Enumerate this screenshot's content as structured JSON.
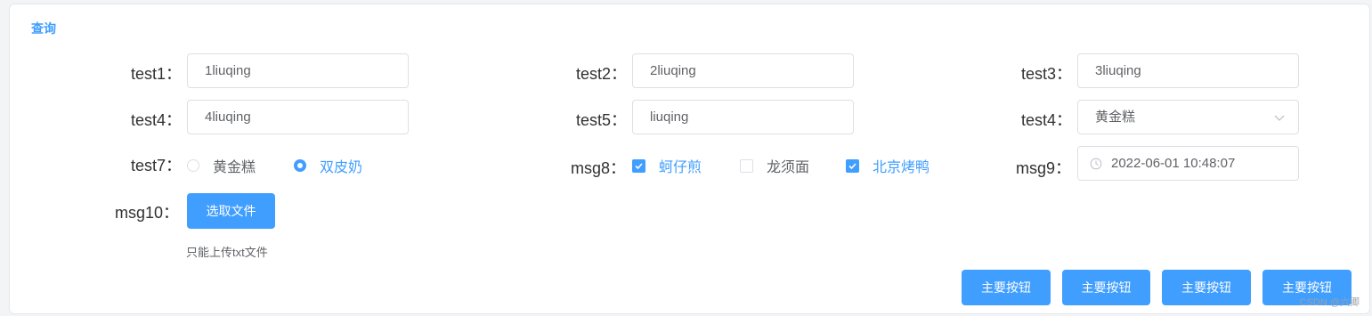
{
  "panel": {
    "title": "查询"
  },
  "row1": {
    "test1": {
      "label": "test1",
      "value": "1liuqing"
    },
    "test2": {
      "label": "test2",
      "value": "2liuqing"
    },
    "test3": {
      "label": "test3",
      "value": "3liuqing"
    }
  },
  "row2": {
    "test4": {
      "label": "test4",
      "value": "4liuqing"
    },
    "test5": {
      "label": "test5",
      "value": "liuqing"
    },
    "test4_select": {
      "label": "test4",
      "value": "黄金糕"
    }
  },
  "row3": {
    "test7": {
      "label": "test7",
      "options": [
        "黄金糕",
        "双皮奶"
      ],
      "selected": "双皮奶"
    },
    "msg8": {
      "label": "msg8",
      "options": [
        "蚵仔煎",
        "龙须面",
        "北京烤鸭"
      ],
      "checked": [
        "蚵仔煎",
        "北京烤鸭"
      ]
    },
    "msg9": {
      "label": "msg9",
      "value": "2022-06-01 10:48:07"
    }
  },
  "row4": {
    "msg10": {
      "label": "msg10",
      "button": "选取文件",
      "hint": "只能上传txt文件"
    }
  },
  "actions": [
    "主要按钮",
    "主要按钮",
    "主要按钮",
    "主要按钮"
  ],
  "colon": "：",
  "watermark": "CSDN @六卿",
  "colors": {
    "primary": "#409eff",
    "border": "#dcdfe6",
    "text": "#606266"
  }
}
